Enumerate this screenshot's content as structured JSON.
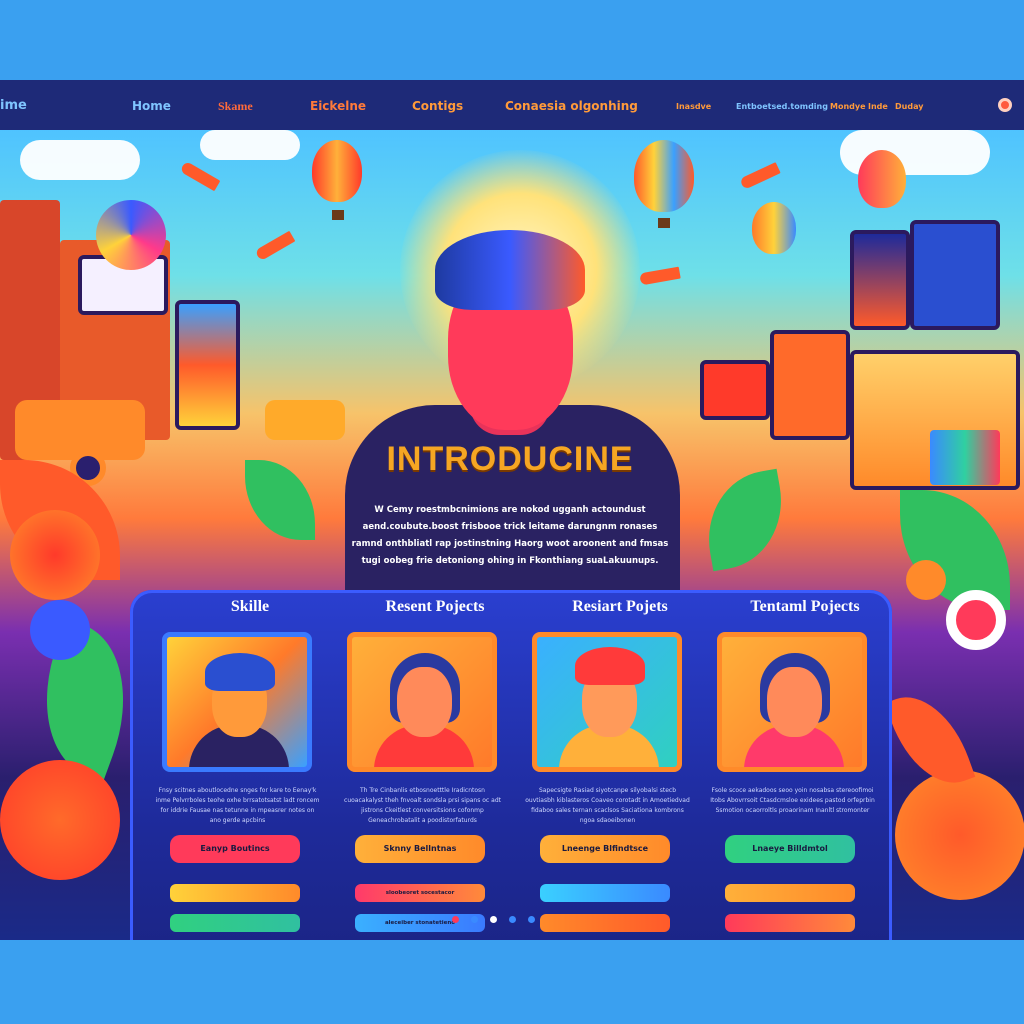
{
  "nav": {
    "brand": "ime",
    "items": [
      "Home",
      "Skame",
      "Eickelne",
      "Contigs",
      "Conaesia olgonhing"
    ],
    "small_items": [
      "Inasdve",
      "Entboetsed.tomding",
      "Mondye",
      "Inde",
      "Duday"
    ]
  },
  "hero": {
    "title": "INTRODUCINE",
    "text": "W Cemy roestmbcnimions are nokod ugganh actoundust aend.coubute.boost frisbooe trick leitame darungnm ronases ramnd onthbliatl rap jostinstning Haorg woot aroonent and fmsas tugi oobeg frie detoniong ohing in Fkonthiang suaLakuunups."
  },
  "cards": [
    {
      "title": "Skille",
      "description": "Fnsy scitnes aboutlocedne snges for kare to Eenay'k inme Pelvrrboles teohe oxhe brrsatotsatst ladt roncem for iddrie Fausae nas tetunne in mpeasrer notes on ano gerde apcbins",
      "main_button": "Eanyp Boutincs",
      "sub_buttons": [
        "",
        ""
      ],
      "stars": "★★★★★"
    },
    {
      "title": "Resent Pojects",
      "description": "Th Tre Cinbanlis etbosnoetttle Iradicntosn cuoacakalyst theh fnvoalt sondsla prsi sipans oc adt jistrons Ckeitlest conversitsions cofonmp Geneachrobatalit a poodistorfaturds",
      "main_button": "Sknny Bellntnas",
      "sub_buttons": [
        "sloobeoret socestacor",
        "aleceiber stonatetieno"
      ],
      "stars": "★★★★★"
    },
    {
      "title": "Resiart Pojets",
      "description": "Sapecsigte Rasiad siyotcanpe silyobalsi stecb ouvtiasbh kiblasteros Coaveo corotadt in Amoetiedvad fidaboo sales ternan scaclsos Saciationa kombrons ngoa sdaoeibonen",
      "main_button": "Lneenge Blfindtsce",
      "sub_buttons": [
        "",
        ""
      ],
      "stars": "★★★★★"
    },
    {
      "title": "Tentaml Pojects",
      "description": "Fsole scoce aekadoos seoo yoin nosabsa stereoofimoi Itobs Abovrrsoit Ctasdcmsloe exidees pastod orfeprbin Ssmotion ocaorroltls proaorinam Inanltl stromonter",
      "main_button": "Lnaeye Billdmtol",
      "sub_buttons": [
        "",
        ""
      ],
      "stars": "★★★★★"
    }
  ],
  "colors": {
    "nav_bg": "#1e2a78",
    "panel_bg": "#2a3fd0",
    "title_orange": "#f6a623"
  }
}
